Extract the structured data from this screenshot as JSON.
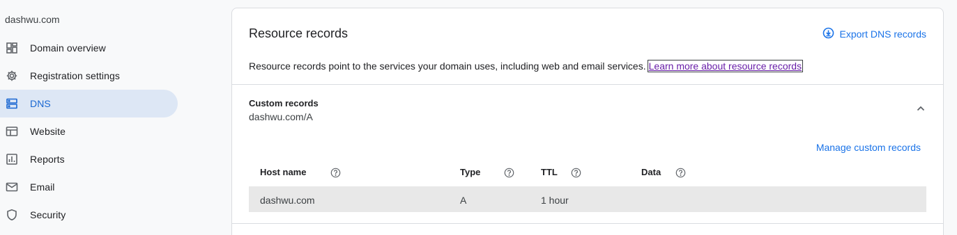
{
  "sidebar": {
    "domain": "dashwu.com",
    "items": [
      {
        "label": "Domain overview",
        "icon": "dashboard-icon"
      },
      {
        "label": "Registration settings",
        "icon": "gear-icon"
      },
      {
        "label": "DNS",
        "icon": "dns-icon",
        "active": true
      },
      {
        "label": "Website",
        "icon": "website-icon"
      },
      {
        "label": "Reports",
        "icon": "reports-icon"
      },
      {
        "label": "Email",
        "icon": "email-icon"
      },
      {
        "label": "Security",
        "icon": "shield-icon"
      }
    ]
  },
  "main": {
    "title": "Resource records",
    "export_label": "Export DNS records",
    "description": "Resource records point to the services your domain uses, including web and email services.",
    "learn_more": "Learn more about resource records",
    "custom_records": {
      "title": "Custom records",
      "subtitle": "dashwu.com/A",
      "manage_label": "Manage custom records",
      "columns": [
        "Host name",
        "Type",
        "TTL",
        "Data"
      ],
      "rows": [
        {
          "host": "dashwu.com",
          "type": "A",
          "ttl": "1 hour",
          "data": ""
        }
      ]
    }
  },
  "colors": {
    "accent": "#1a73e8",
    "active_bg": "#dde7f5",
    "link_visited": "#681da8"
  }
}
